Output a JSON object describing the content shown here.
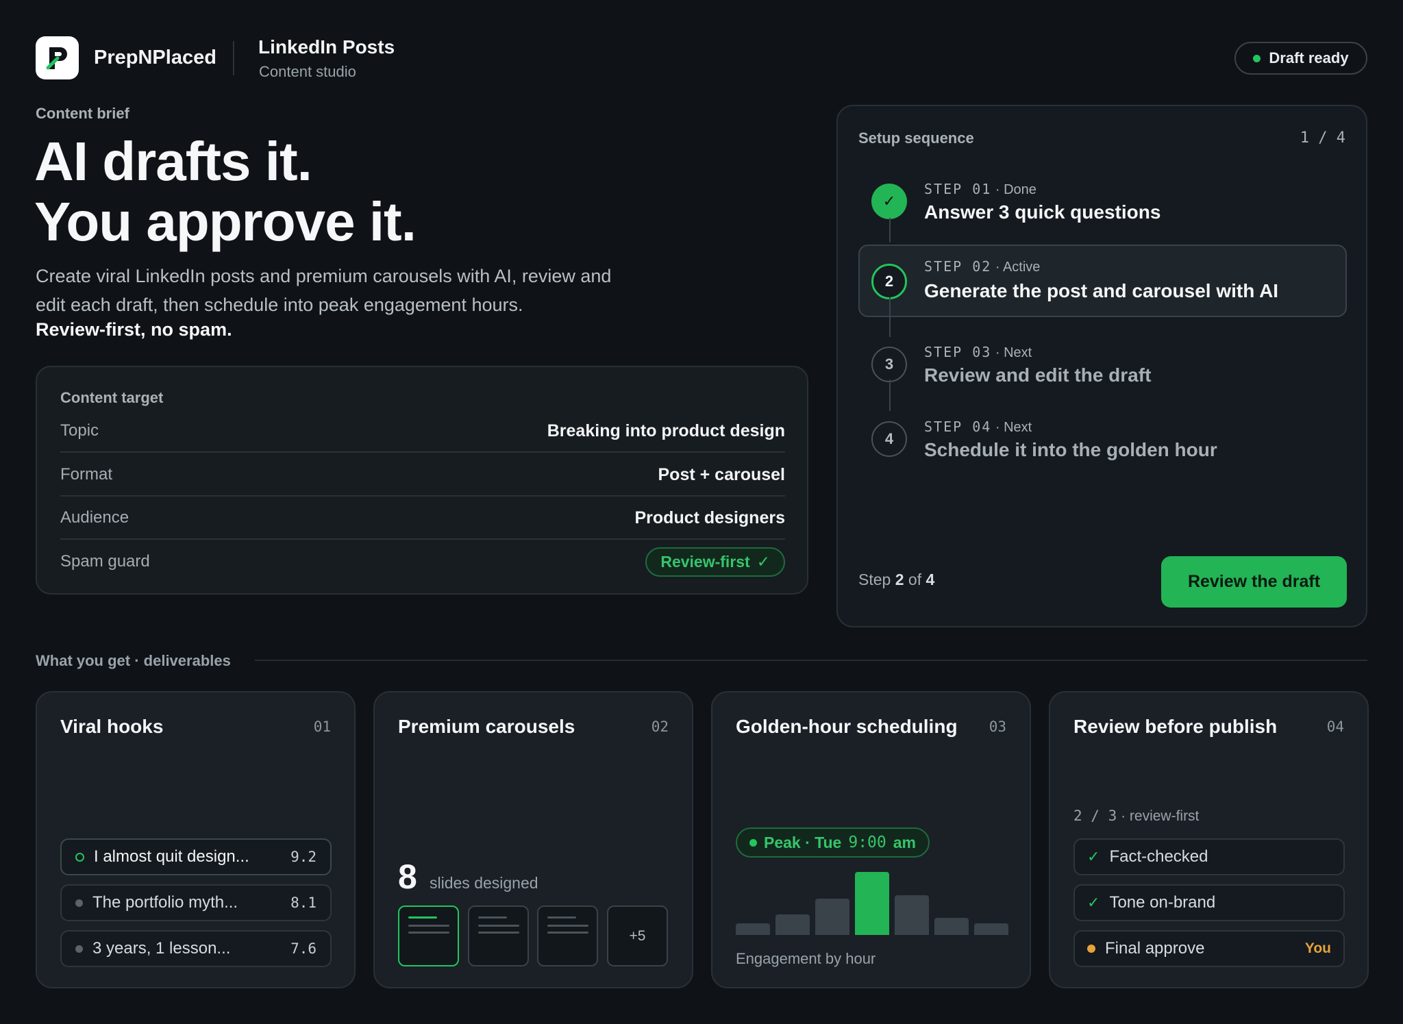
{
  "header": {
    "brand": "PrepNPlaced",
    "title": "LinkedIn Posts",
    "subtitle": "Content studio",
    "status": "Draft ready",
    "logo_icon": "prepnplaced-logo-icon"
  },
  "colors": {
    "accent": "#22c55e",
    "background": "#0f1317",
    "warning": "#e8a23a"
  },
  "hero": {
    "label": "Content brief",
    "headline_line1": "AI drafts it.",
    "headline_line2": "You approve it.",
    "description": "Create viral LinkedIn posts and premium carousels with AI, review and edit each draft, then schedule into peak engagement hours.",
    "emphasis": "Review-first, no spam."
  },
  "content_target": {
    "title": "Content target",
    "rows": [
      {
        "label": "Topic",
        "value": "Breaking into product design"
      },
      {
        "label": "Format",
        "value": "Post + carousel"
      },
      {
        "label": "Audience",
        "value": "Product designers"
      },
      {
        "label": "Spam guard",
        "value": "Review-first"
      }
    ]
  },
  "setup": {
    "title": "Setup sequence",
    "progress": "1 / 4",
    "steps": [
      {
        "num": "✓",
        "meta": "STEP 01",
        "status": "Done",
        "text": "Answer 3 quick questions"
      },
      {
        "num": "2",
        "meta": "STEP 02",
        "status": "Active",
        "text": "Generate the post and carousel with AI"
      },
      {
        "num": "3",
        "meta": "STEP 03",
        "status": "Next",
        "text": "Review and edit the draft"
      },
      {
        "num": "4",
        "meta": "STEP 04",
        "status": "Next",
        "text": "Schedule it into the golden hour"
      }
    ],
    "footer_prefix": "Step",
    "footer_current": "2",
    "footer_of": "of",
    "footer_total": "4",
    "button": "Review the draft"
  },
  "deliverables": {
    "label": "What you get · deliverables",
    "cards": [
      {
        "title": "Viral hooks",
        "num": "01",
        "hooks": [
          {
            "text": "I almost quit design...",
            "score": "9.2"
          },
          {
            "text": "The portfolio myth...",
            "score": "8.1"
          },
          {
            "text": "3 years, 1 lesson...",
            "score": "7.6"
          }
        ]
      },
      {
        "title": "Premium carousels",
        "num": "02",
        "slides_count": "8",
        "slides_label": "slides designed",
        "more": "+5"
      },
      {
        "title": "Golden-hour scheduling",
        "num": "03",
        "peak_prefix": "Peak · Tue",
        "peak_time": "9:00",
        "peak_suffix": "am",
        "engagement_label": "Engagement by hour",
        "engagement_levels": [
          0.18,
          0.33,
          0.58,
          1.0,
          0.63,
          0.27,
          0.18
        ]
      },
      {
        "title": "Review before publish",
        "num": "04",
        "count_mono": "2 / 3",
        "count_suffix": "· review-first",
        "checks": [
          {
            "text": "Fact-checked"
          },
          {
            "text": "Tone on-brand"
          },
          {
            "text": "Final approve",
            "badge": "You"
          }
        ]
      }
    ]
  }
}
